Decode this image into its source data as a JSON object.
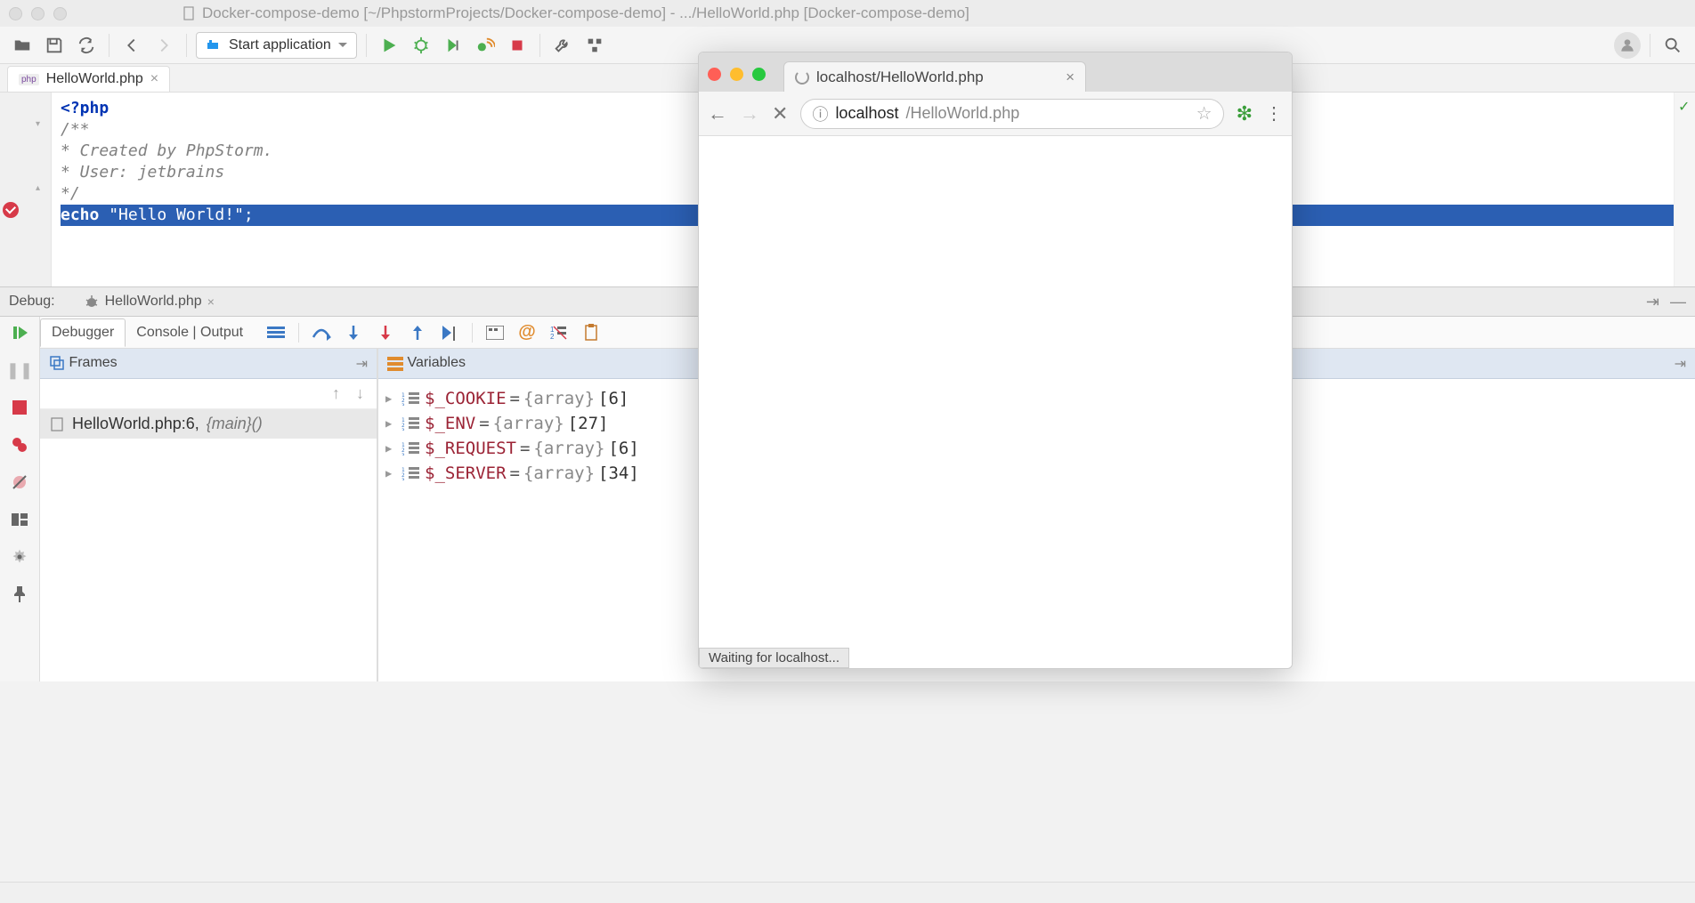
{
  "window": {
    "title": "Docker-compose-demo [~/PhpstormProjects/Docker-compose-demo] - .../HelloWorld.php [Docker-compose-demo]"
  },
  "toolbar": {
    "run_config_label": "Start application"
  },
  "editor": {
    "tab_name": "HelloWorld.php",
    "lines": {
      "l1": "<?php",
      "l2": "/**",
      "l3": " * Created by PhpStorm.",
      "l4": " * User: jetbrains",
      "l5": " */",
      "l6a": "echo",
      "l6b": "\"Hello World!\"",
      "l6c": ";"
    }
  },
  "debug": {
    "label": "Debug:",
    "session_tab": "HelloWorld.php",
    "tabs": {
      "debugger": "Debugger",
      "console": "Console | Output"
    },
    "frames": {
      "title": "Frames",
      "item_file": "HelloWorld.php:6, ",
      "item_main": "{main}()"
    },
    "variables": {
      "title": "Variables",
      "rows": [
        {
          "name": "$_COOKIE",
          "type": "{array}",
          "count": "[6]"
        },
        {
          "name": "$_ENV",
          "type": "{array}",
          "count": "[27]"
        },
        {
          "name": "$_REQUEST",
          "type": "{array}",
          "count": "[6]"
        },
        {
          "name": "$_SERVER",
          "type": "{array}",
          "count": "[34]"
        }
      ]
    }
  },
  "browser": {
    "tab_title": "localhost/HelloWorld.php",
    "url_host": "localhost",
    "url_path": "/HelloWorld.php",
    "status": "Waiting for localhost..."
  }
}
